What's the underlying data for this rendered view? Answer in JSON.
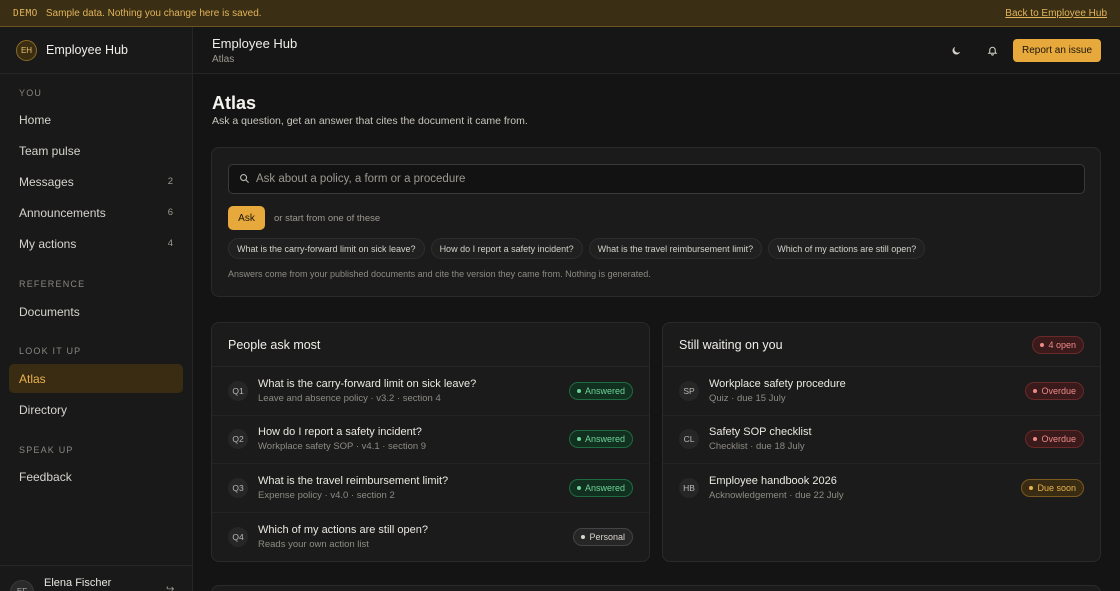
{
  "demo_bar": {
    "tag": "DEMO",
    "message": "Sample data. Nothing you change here is saved.",
    "back_link": "Back to Employee Hub"
  },
  "brand": {
    "initials": "EH",
    "name": "Employee Hub"
  },
  "sidebar": {
    "sections": [
      {
        "label": "YOU"
      },
      {
        "label": "REFERENCE"
      },
      {
        "label": "LOOK IT UP"
      },
      {
        "label": "SPEAK UP"
      }
    ],
    "items": [
      {
        "label": "Home",
        "count": ""
      },
      {
        "label": "Team pulse",
        "count": ""
      },
      {
        "label": "Messages",
        "count": "2"
      },
      {
        "label": "Announcements",
        "count": "6"
      },
      {
        "label": "My actions",
        "count": "4"
      },
      {
        "label": "Documents",
        "count": ""
      },
      {
        "label": "Atlas",
        "count": ""
      },
      {
        "label": "Directory",
        "count": ""
      },
      {
        "label": "Feedback",
        "count": ""
      }
    ],
    "active_item": "Atlas",
    "user": {
      "initials": "EF",
      "name": "Elena Fischer"
    }
  },
  "header": {
    "title": "Employee Hub",
    "breadcrumb": "Atlas",
    "report_label": "Report an issue",
    "icons": [
      "moon-icon",
      "bell-icon"
    ]
  },
  "page": {
    "title": "Atlas",
    "subtitle": "Ask a question, get an answer that cites the document it came from."
  },
  "ask": {
    "placeholder": "Ask about a policy, a form or a procedure",
    "value": "",
    "button": "Ask",
    "hint": "or start from one of these",
    "suggestions": [
      "What is the carry-forward limit on sick leave?",
      "How do I report a safety incident?",
      "What is the travel reimbursement limit?",
      "Which of my actions are still open?"
    ],
    "footnote": "Answers come from your published documents and cite the version they came from. Nothing is generated."
  },
  "popular": {
    "title": "People ask most",
    "rows": [
      {
        "code": "Q1",
        "title": "What is the carry-forward limit on sick leave?",
        "sub": "Leave and absence policy · v3.2 · section 4",
        "status": "Answered"
      },
      {
        "code": "Q2",
        "title": "How do I report a safety incident?",
        "sub": "Workplace safety SOP · v4.1 · section 9",
        "status": "Answered"
      },
      {
        "code": "Q3",
        "title": "What is the travel reimbursement limit?",
        "sub": "Expense policy · v4.0 · section 2",
        "status": "Answered"
      },
      {
        "code": "Q4",
        "title": "Which of my actions are still open?",
        "sub": "Reads your own action list",
        "status": "Personal"
      }
    ]
  },
  "waiting": {
    "title": "Still waiting on you",
    "count": "4 open",
    "rows": [
      {
        "code": "SP",
        "title": "Workplace safety procedure",
        "sub": "Quiz · due 15 July",
        "status": "Overdue"
      },
      {
        "code": "CL",
        "title": "Safety SOP checklist",
        "sub": "Checklist · due 18 July",
        "status": "Overdue"
      },
      {
        "code": "HB",
        "title": "Employee handbook 2026",
        "sub": "Acknowledgement · due 22 July",
        "status": "Due soon"
      }
    ]
  },
  "colors": {
    "accent": "#e8a93c",
    "background": "#141414",
    "answered": "#6fd39a",
    "overdue": "#ef8a8a",
    "due_soon": "#e8b24d"
  }
}
